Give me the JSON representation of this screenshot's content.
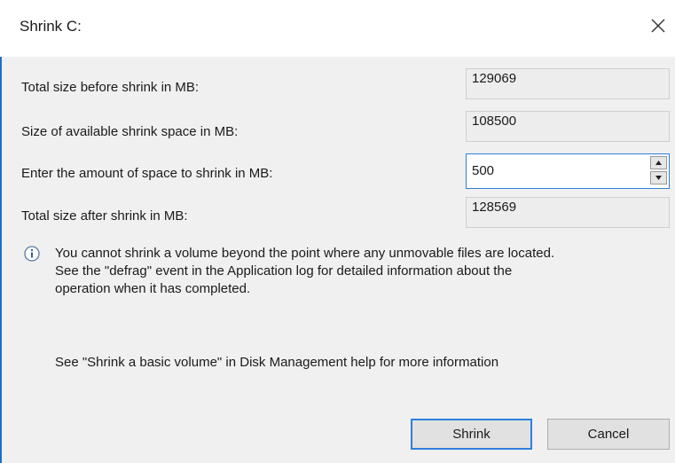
{
  "window": {
    "title": "Shrink C:",
    "close_icon": "close-icon"
  },
  "fields": {
    "total_before": {
      "label": "Total size before shrink in MB:",
      "value": "129069"
    },
    "available": {
      "label": "Size of available shrink space in MB:",
      "value": "108500"
    },
    "amount": {
      "label": "Enter the amount of space to shrink in MB:",
      "value": "500"
    },
    "total_after": {
      "label": "Total size after shrink in MB:",
      "value": "128569"
    }
  },
  "info": {
    "icon": "info-icon",
    "line1": "You cannot shrink a volume beyond the point where any unmovable files are located.",
    "line2": "See the \"defrag\" event in the Application log for detailed information about the",
    "line3": "operation when it has completed."
  },
  "help": "See \"Shrink a basic volume\" in Disk Management help for more information",
  "buttons": {
    "shrink": "Shrink",
    "cancel": "Cancel"
  },
  "colors": {
    "accent": "#2f7fdc",
    "dialog_bg": "#f0f0f0"
  }
}
